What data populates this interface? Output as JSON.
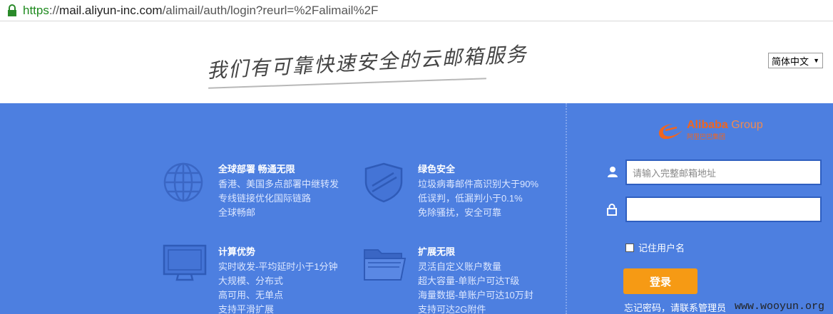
{
  "browser": {
    "url_scheme": "https",
    "url_sep": "://",
    "url_host": "mail.aliyun-inc.com",
    "url_path": "/alimail/auth/login?reurl=%2Falimail%2F"
  },
  "header": {
    "slogan": "我们有可靠快速安全的云邮箱服务",
    "language": "简体中文",
    "language_arrow": "▼"
  },
  "features": [
    {
      "icon": "globe-icon",
      "title": "全球部署  畅通无限",
      "lines": [
        "香港、美国多点部署中继转发",
        "专线链接优化国际链路",
        "全球畅邮"
      ]
    },
    {
      "icon": "shield-icon",
      "title": "绿色安全",
      "lines": [
        "垃圾病毒邮件高识别大于90%",
        "低误判，低漏判小于0.1%",
        "免除骚扰，安全可靠"
      ]
    },
    {
      "icon": "monitor-icon",
      "title": "计算优势",
      "lines": [
        "实时收发-平均延时小于1分钟",
        "大规模、分布式",
        "高可用、无单点",
        "支持平滑扩展"
      ]
    },
    {
      "icon": "folder-icon",
      "title": "扩展无限",
      "lines": [
        "灵活自定义账户数量",
        "超大容量-单账户可达T级",
        "海量数据-单账户可达10万封",
        "支持可达2G附件"
      ]
    }
  ],
  "login": {
    "logo_brand": "Alibaba",
    "logo_group": "Group",
    "logo_sub": "阿里巴巴集团",
    "email_placeholder": "请输入完整邮箱地址",
    "password_value": "",
    "remember_label": "记住用户名",
    "submit_label": "登录",
    "forgot_text": "忘记密码，请联系管理员"
  },
  "watermark": "www.wooyun.org",
  "colors": {
    "primary_bg": "#4d7fe0",
    "button": "#f69a14",
    "brand": "#f0651f"
  }
}
